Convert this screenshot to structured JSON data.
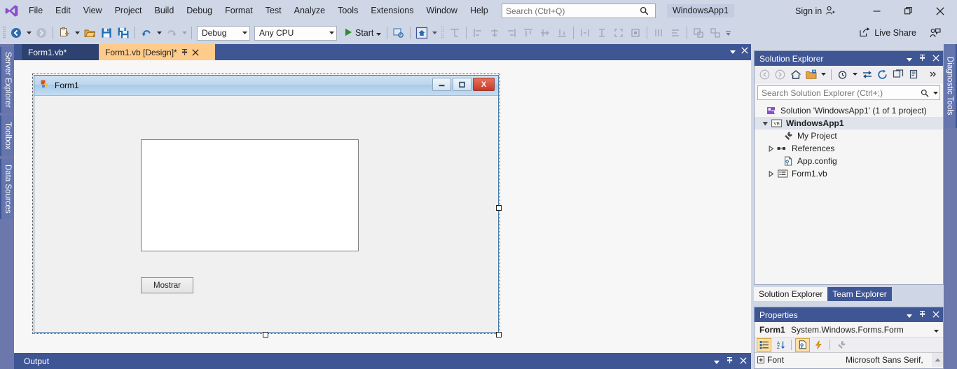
{
  "menubar": {
    "logo_icon": "visual-studio-logo",
    "items": [
      "File",
      "Edit",
      "View",
      "Project",
      "Build",
      "Debug",
      "Format",
      "Test",
      "Analyze",
      "Tools",
      "Extensions",
      "Window",
      "Help"
    ],
    "search_placeholder": "Search (Ctrl+Q)",
    "search_value": "",
    "search_icon": "magnifier-icon",
    "project_name": "WindowsApp1",
    "sign_in": "Sign in",
    "sign_in_icon": "person-add-icon",
    "window_controls": [
      {
        "name": "minimize-button",
        "icon": "minimize-icon"
      },
      {
        "name": "restore-button",
        "icon": "restore-icon"
      },
      {
        "name": "close-button",
        "icon": "close-icon"
      }
    ]
  },
  "toolbar": {
    "navigate_back": "Navigate Backward",
    "navigate_forward": "Navigate Forward",
    "new_project": "New Project",
    "open_file": "Open File",
    "save": "Save",
    "save_all": "Save All",
    "undo": "Undo",
    "redo": "Redo",
    "configuration": "Debug",
    "platform": "Any CPU",
    "start_label": "Start",
    "start_icon": "play-icon",
    "live_share": "Live Share",
    "live_share_icon": "share-icon",
    "feedback_icon": "feedback-icon",
    "overflow_icon": "chevron-down-icon"
  },
  "left_rail": {
    "tabs": [
      "Server Explorer",
      "Toolbox",
      "Data Sources"
    ]
  },
  "right_rail": {
    "tabs": [
      "Diagnostic Tools"
    ]
  },
  "document_tabs": {
    "tabs": [
      {
        "label": "Form1.vb*",
        "active": false
      },
      {
        "label": "Form1.vb [Design]*",
        "active": true
      }
    ],
    "pin_icon": "pin-icon",
    "close_icon": "close-icon",
    "dropdown_icon": "chevron-down-icon",
    "panel_close_icon": "close-icon"
  },
  "designer": {
    "form": {
      "title": "Form1",
      "icon": "vb-form-icon",
      "minimize_icon": "minimize-icon",
      "maximize_icon": "maximize-icon",
      "close_label": "X",
      "listbox_value": "",
      "button_label": "Mostrar"
    }
  },
  "output_panel": {
    "title": "Output",
    "dropdown_icon": "chevron-down-icon",
    "pin_icon": "pin-icon",
    "close_icon": "close-icon"
  },
  "solution_explorer": {
    "title": "Solution Explorer",
    "dropdown_icon": "chevron-down-icon",
    "pin_icon": "pin-icon",
    "close_icon": "close-icon",
    "toolbar_icons": [
      "back-icon",
      "forward-icon",
      "home-icon",
      "pending-changes-icon",
      "chevron-down-icon",
      "show-all-files-icon",
      "chevron-down-icon",
      "sync-with-active-document-icon",
      "refresh-icon",
      "collapse-all-icon",
      "properties-icon",
      "overflow-icon"
    ],
    "search_placeholder": "Search Solution Explorer (Ctrl+;)",
    "search_value": "",
    "search_icon": "magnifier-icon",
    "tree": [
      {
        "label": "Solution 'WindowsApp1' (1 of 1 project)",
        "indent": 0,
        "twisty": "none",
        "icon": "solution-icon",
        "bold": false,
        "selected": false
      },
      {
        "label": "WindowsApp1",
        "indent": 1,
        "twisty": "expanded",
        "icon": "vb-project-icon",
        "bold": true,
        "selected": true
      },
      {
        "label": "My Project",
        "indent": 2,
        "twisty": "none",
        "icon": "wrench-icon",
        "bold": false,
        "selected": false
      },
      {
        "label": "References",
        "indent": 2,
        "twisty": "collapsed",
        "icon": "references-icon",
        "bold": false,
        "selected": false
      },
      {
        "label": "App.config",
        "indent": 2,
        "twisty": "none",
        "icon": "config-file-icon",
        "bold": false,
        "selected": false
      },
      {
        "label": "Form1.vb",
        "indent": 2,
        "twisty": "collapsed",
        "icon": "form-file-icon",
        "bold": false,
        "selected": false
      }
    ],
    "bottom_tabs": [
      {
        "label": "Solution Explorer",
        "active": true
      },
      {
        "label": "Team Explorer",
        "active": false
      }
    ]
  },
  "properties": {
    "title": "Properties",
    "dropdown_icon": "chevron-down-icon",
    "pin_icon": "pin-icon",
    "close_icon": "close-icon",
    "object_name": "Form1",
    "object_type": "System.Windows.Forms.Form",
    "object_dropdown_icon": "chevron-down-icon",
    "toolbar": [
      {
        "name": "categorized-button",
        "icon": "categorized-icon",
        "active": true
      },
      {
        "name": "alphabetical-button",
        "icon": "alphabetical-sort-icon",
        "active": false
      },
      {
        "name": "properties-button",
        "icon": "properties-page-icon",
        "active": true
      },
      {
        "name": "events-button",
        "icon": "lightning-bolt-icon",
        "active": false
      },
      {
        "name": "property-pages-button",
        "icon": "wrench-icon",
        "active": false
      }
    ],
    "rows": [
      {
        "name": "Font",
        "value": "Microsoft Sans Serif,",
        "expander": "collapsed"
      }
    ],
    "scroll_up_icon": "triangle-up-icon"
  },
  "colors": {
    "chrome": "#cfd6e5",
    "accent_panel_header": "#3f5695",
    "active_tab": "#ffcb8b",
    "rail": "#6c77ab",
    "designer_bg": "#f7f7f7",
    "form_bg": "#f0f0f0"
  }
}
